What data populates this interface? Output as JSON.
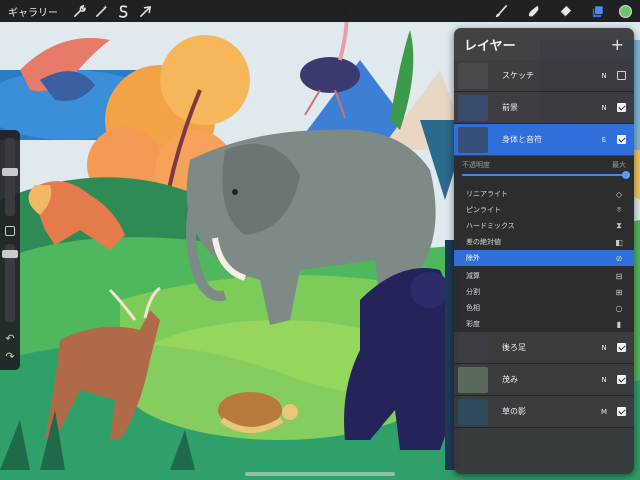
{
  "topbar": {
    "gallery_label": "ギャラリー",
    "left_tools": [
      "wrench-icon",
      "magic-wand-icon",
      "selection-s-icon",
      "transform-arrow-icon"
    ],
    "right_tools": [
      "brush-icon",
      "smudge-icon",
      "eraser-icon",
      "layers-icon"
    ],
    "current_color": "#6cc56a"
  },
  "layers_panel": {
    "title": "レイヤー",
    "add_symbol": "+",
    "layers_top": [
      {
        "name": "スケッチ",
        "mode": "N",
        "visible": false,
        "thumb": "#4a4a4e"
      },
      {
        "name": "前景",
        "mode": "N",
        "visible": true,
        "thumb": "#3a4c6c"
      },
      {
        "name": "身体と音符",
        "mode": "E",
        "visible": true,
        "thumb": "#36507a",
        "active": true
      }
    ],
    "opacity_label": "不透明度",
    "opacity_max_label": "最大",
    "opacity_value": 1.0,
    "blend_modes": [
      {
        "label": "リニアライト",
        "icon": "◇"
      },
      {
        "label": "ピンライト",
        "icon": "⌾"
      },
      {
        "label": "ハードミックス",
        "icon": "⧗"
      },
      {
        "label": "差の絶対値",
        "icon": "◧"
      },
      {
        "label": "除外",
        "icon": "⊘",
        "selected": true
      },
      {
        "label": "減算",
        "icon": "⊟",
        "gap": true
      },
      {
        "label": "分割",
        "icon": "⊞"
      },
      {
        "label": "色相",
        "icon": "○"
      },
      {
        "label": "彩度",
        "icon": "▮"
      }
    ],
    "layers_bottom": [
      {
        "name": "後ろ足",
        "mode": "N",
        "visible": true,
        "thumb": "#3d3d44"
      },
      {
        "name": "茂み",
        "mode": "N",
        "visible": true,
        "thumb": "#5a6a5a"
      },
      {
        "name": "草の影",
        "mode": "M",
        "visible": true,
        "thumb": "#2f4a5c"
      }
    ]
  }
}
